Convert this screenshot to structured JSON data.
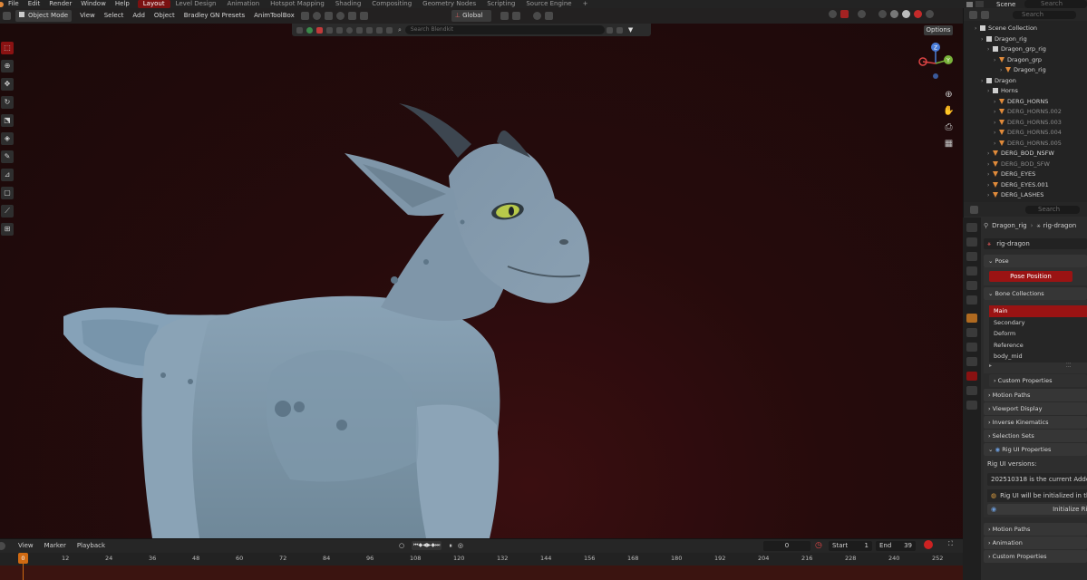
{
  "topbar": {
    "menus": [
      "File",
      "Edit",
      "Render",
      "Window",
      "Help"
    ],
    "workspaces": [
      "Layout",
      "Level Design",
      "Animation",
      "Hotspot Mapping",
      "Shading",
      "Compositing",
      "Geometry Nodes",
      "Scripting",
      "Source Engine"
    ],
    "add_workspace": "+",
    "scene_label": "Scene",
    "search_placeholder": "Search"
  },
  "viewport": {
    "mode": "Object Mode",
    "menus": [
      "View",
      "Select",
      "Add",
      "Object",
      "Bradley GN Presets",
      "AnimToolBox"
    ],
    "orientation": "Global",
    "options": "Options",
    "search_placeholder": "Search Blendkit",
    "gizmo": {
      "z": "Z",
      "y": "Y",
      "x": "X"
    }
  },
  "outliner": {
    "search_placeholder": "Search",
    "rows": [
      {
        "label": "Scene Collection",
        "indent": 0,
        "dim": false,
        "color": "#cfcfcf"
      },
      {
        "label": "Dragon_rig",
        "indent": 1,
        "dim": false,
        "color": "#cfcfcf"
      },
      {
        "label": "Dragon_grp_rig",
        "indent": 2,
        "dim": false,
        "color": "#cfcfcf"
      },
      {
        "label": "Dragon_grp",
        "indent": 3,
        "dim": false,
        "color": "#e08a3a"
      },
      {
        "label": "Dragon_rig",
        "indent": 4,
        "dim": false,
        "color": "#e08a3a"
      },
      {
        "label": "Dragon",
        "indent": 1,
        "dim": false,
        "color": "#cfcfcf"
      },
      {
        "label": "Horns",
        "indent": 2,
        "dim": false,
        "color": "#cfcfcf"
      },
      {
        "label": "DERG_HORNS",
        "indent": 3,
        "dim": false,
        "color": "#e08a3a"
      },
      {
        "label": "DERG_HORNS.002",
        "indent": 3,
        "dim": true,
        "color": "#e08a3a"
      },
      {
        "label": "DERG_HORNS.003",
        "indent": 3,
        "dim": true,
        "color": "#e08a3a"
      },
      {
        "label": "DERG_HORNS.004",
        "indent": 3,
        "dim": true,
        "color": "#e08a3a"
      },
      {
        "label": "DERG_HORNS.005",
        "indent": 3,
        "dim": true,
        "color": "#e08a3a"
      },
      {
        "label": "DERG_BOD_NSFW",
        "indent": 2,
        "dim": false,
        "color": "#e08a3a"
      },
      {
        "label": "DERG_BOD_SFW",
        "indent": 2,
        "dim": true,
        "color": "#e08a3a"
      },
      {
        "label": "DERG_EYES",
        "indent": 2,
        "dim": false,
        "color": "#e08a3a"
      },
      {
        "label": "DERG_EYES.001",
        "indent": 2,
        "dim": false,
        "color": "#e08a3a"
      },
      {
        "label": "DERG_LASHES",
        "indent": 2,
        "dim": false,
        "color": "#e08a3a"
      }
    ]
  },
  "properties": {
    "search_placeholder": "Search",
    "breadcrumb": [
      "Dragon_rig",
      "rig-dragon"
    ],
    "data_name": "rig-dragon",
    "pose": {
      "header": "Pose",
      "button": "Pose Position"
    },
    "bone_collections": {
      "header": "Bone Collections",
      "items": [
        "Main",
        "Secondary",
        "Deform",
        "Reference",
        "body_mid"
      ],
      "active": "Main"
    },
    "custom_properties_inner": "Custom Properties",
    "panels_mid": [
      "Motion Paths",
      "Viewport Display",
      "Inverse Kinematics",
      "Selection Sets"
    ],
    "rig_ui": {
      "header": "Rig UI Properties",
      "versions_label": "Rig UI versions:",
      "version_text": "202510318 is the current Addon ve",
      "init_text": "Rig UI will be initialized in this",
      "init_button": "Initialize Ri"
    },
    "panels_bottom": [
      "Motion Paths",
      "Animation",
      "Custom Properties"
    ]
  },
  "timeline": {
    "menus": [
      "View",
      "Marker",
      "Playback"
    ],
    "current_frame": "0",
    "start_label": "Start",
    "start": "1",
    "end_label": "End",
    "end": "39",
    "playhead": "0",
    "ticks": [
      "12",
      "24",
      "36",
      "48",
      "60",
      "72",
      "84",
      "96",
      "108",
      "120",
      "132",
      "144",
      "156",
      "168",
      "180",
      "192",
      "204",
      "216",
      "228",
      "240",
      "252"
    ]
  }
}
